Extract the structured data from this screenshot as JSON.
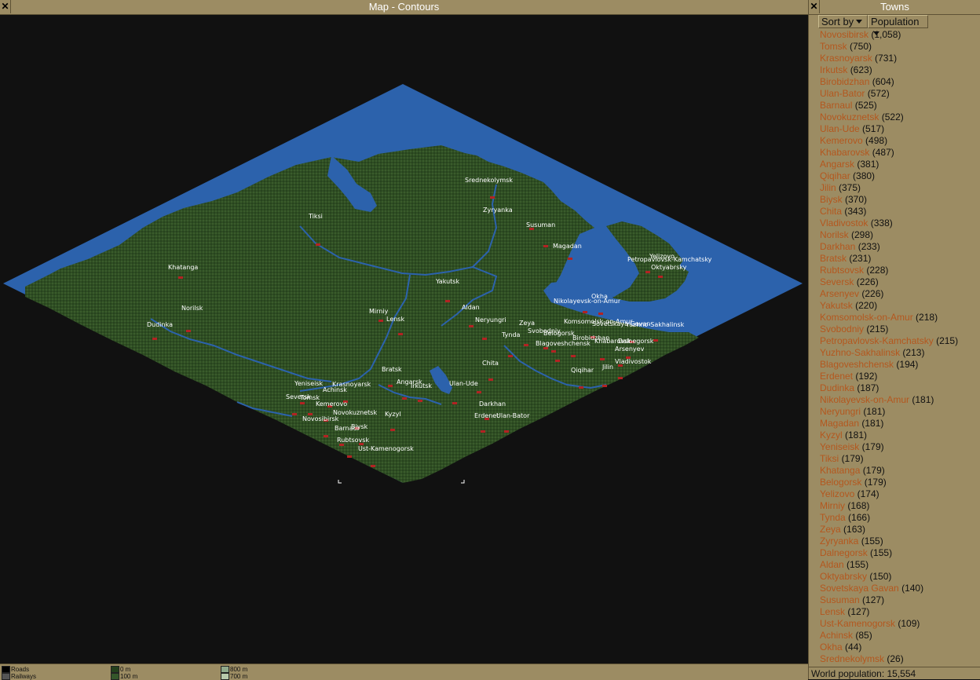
{
  "map_window": {
    "title": "Map - Contours",
    "close_label": "✕"
  },
  "legend": {
    "roads": "Roads",
    "railways": "Railways",
    "h0": "0 m",
    "h100": "100 m",
    "h800": "800 m",
    "h700": "700 m",
    "colors": {
      "roads": "#000000",
      "railways": "#555555",
      "h0": "#24401c",
      "h100": "#34562a",
      "h800": "#8fa98a",
      "h700": "#b8c9ac"
    }
  },
  "colors": {
    "sea": "#2c62ac",
    "land": "#2f4e23",
    "town_marker": "#b22323",
    "ui_panel": "#9c8c63"
  },
  "map_labels": [
    "Srednekolymsk",
    "Zyryanka",
    "Susuman",
    "Magadan",
    "Yelizovo",
    "Petropavlovsk-Kamchatsky",
    "Oktyabrsky",
    "Tiksi",
    "Khatanga",
    "Yakutsk",
    "Okha",
    "Nikolayevsk-on-Amur",
    "Norilsk",
    "Aldan",
    "Mirniy",
    "Lensk",
    "Neryungri",
    "Dudinka",
    "Zeya",
    "Komsomolsk-on-Amur",
    "Svobodniy",
    "Belogorsk",
    "Sovetskaya Gavan",
    "Yuzhno-Sakhalinsk",
    "Tynda",
    "Birobidzhan",
    "Blagoveshchensk",
    "Khabarovsk",
    "Dalnegorsk",
    "Arsenyev",
    "Vladivostok",
    "Chita",
    "Qiqihar",
    "Jilin",
    "Bratsk",
    "Ulan-Ude",
    "Angarsk",
    "Irkutsk",
    "Yeniseisk",
    "Krasnoyarsk",
    "Achinsk",
    "Seversk",
    "Tomsk",
    "Kemerovo",
    "Darkhan",
    "Erdenet",
    "Ulan-Bator",
    "Novokuznetsk",
    "Kyzyl",
    "Novosibirsk",
    "Biysk",
    "Barnaul",
    "Rubtsovsk",
    "Ust-Kamenogorsk"
  ],
  "towns_window": {
    "title": "Towns",
    "close_label": "✕",
    "sort_by_label": "Sort by",
    "sort_value": "Population",
    "towns": [
      {
        "name": "Novosibirsk",
        "pop": "(1,058)"
      },
      {
        "name": "Tomsk",
        "pop": "(750)"
      },
      {
        "name": "Krasnoyarsk",
        "pop": "(731)"
      },
      {
        "name": "Irkutsk",
        "pop": "(623)"
      },
      {
        "name": "Birobidzhan",
        "pop": "(604)"
      },
      {
        "name": "Ulan-Bator",
        "pop": "(572)"
      },
      {
        "name": "Barnaul",
        "pop": "(525)"
      },
      {
        "name": "Novokuznetsk",
        "pop": "(522)"
      },
      {
        "name": "Ulan-Ude",
        "pop": "(517)"
      },
      {
        "name": "Kemerovo",
        "pop": "(498)"
      },
      {
        "name": "Khabarovsk",
        "pop": "(487)"
      },
      {
        "name": "Angarsk",
        "pop": "(381)"
      },
      {
        "name": "Qiqihar",
        "pop": "(380)"
      },
      {
        "name": "Jilin",
        "pop": "(375)"
      },
      {
        "name": "Biysk",
        "pop": "(370)"
      },
      {
        "name": "Chita",
        "pop": "(343)"
      },
      {
        "name": "Vladivostok",
        "pop": "(338)"
      },
      {
        "name": "Norilsk",
        "pop": "(298)"
      },
      {
        "name": "Darkhan",
        "pop": "(233)"
      },
      {
        "name": "Bratsk",
        "pop": "(231)"
      },
      {
        "name": "Rubtsovsk",
        "pop": "(228)"
      },
      {
        "name": "Seversk",
        "pop": "(226)"
      },
      {
        "name": "Arsenyev",
        "pop": "(226)"
      },
      {
        "name": "Yakutsk",
        "pop": "(220)"
      },
      {
        "name": "Komsomolsk-on-Amur",
        "pop": "(218)"
      },
      {
        "name": "Svobodniy",
        "pop": "(215)"
      },
      {
        "name": "Petropavlovsk-Kamchatsky",
        "pop": "(215)"
      },
      {
        "name": "Yuzhno-Sakhalinsk",
        "pop": "(213)"
      },
      {
        "name": "Blagoveshchensk",
        "pop": "(194)"
      },
      {
        "name": "Erdenet",
        "pop": "(192)"
      },
      {
        "name": "Dudinka",
        "pop": "(187)"
      },
      {
        "name": "Nikolayevsk-on-Amur",
        "pop": "(181)"
      },
      {
        "name": "Neryungri",
        "pop": "(181)"
      },
      {
        "name": "Magadan",
        "pop": "(181)"
      },
      {
        "name": "Kyzyl",
        "pop": "(181)"
      },
      {
        "name": "Yeniseisk",
        "pop": "(179)"
      },
      {
        "name": "Tiksi",
        "pop": "(179)"
      },
      {
        "name": "Khatanga",
        "pop": "(179)"
      },
      {
        "name": "Belogorsk",
        "pop": "(179)"
      },
      {
        "name": "Yelizovo",
        "pop": "(174)"
      },
      {
        "name": "Mirniy",
        "pop": "(168)"
      },
      {
        "name": "Tynda",
        "pop": "(166)"
      },
      {
        "name": "Zeya",
        "pop": "(163)"
      },
      {
        "name": "Zyryanka",
        "pop": "(155)"
      },
      {
        "name": "Dalnegorsk",
        "pop": "(155)"
      },
      {
        "name": "Aldan",
        "pop": "(155)"
      },
      {
        "name": "Oktyabrsky",
        "pop": "(150)"
      },
      {
        "name": "Sovetskaya Gavan",
        "pop": "(140)"
      },
      {
        "name": "Susuman",
        "pop": "(127)"
      },
      {
        "name": "Lensk",
        "pop": "(127)"
      },
      {
        "name": "Ust-Kamenogorsk",
        "pop": "(109)"
      },
      {
        "name": "Achinsk",
        "pop": "(85)"
      },
      {
        "name": "Okha",
        "pop": "(44)"
      },
      {
        "name": "Srednekolymsk",
        "pop": "(26)"
      }
    ],
    "world_population": "World population: 15,554"
  }
}
